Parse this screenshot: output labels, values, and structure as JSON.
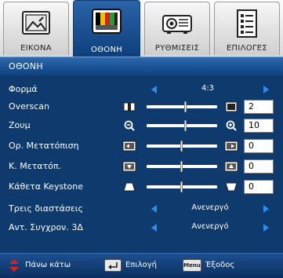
{
  "tabs": [
    {
      "label": "ΕΙΚΟΝΑ",
      "icon": "picture-icon"
    },
    {
      "label": "ΟΘΟΝΗ",
      "icon": "screen-icon"
    },
    {
      "label": "ΡΥΘΜΙΣΕΙΣ",
      "icon": "projector-icon"
    },
    {
      "label": "ΕΠΙΛΟΓΕΣ",
      "icon": "options-icon"
    }
  ],
  "title": "ΟΘΟΝΗ",
  "rows": {
    "forma": {
      "label": "Φορμά",
      "value": "4:3"
    },
    "overscan": {
      "label": "Overscan",
      "value": "2",
      "level": 0.55
    },
    "zoom": {
      "label": "Ζουμ",
      "value": "10",
      "level": 0.55
    },
    "hshift": {
      "label": "Ορ. Μετατόπιση",
      "value": "0",
      "level": 0.5
    },
    "vshift": {
      "label": "Κ. Μετατόπ.",
      "value": "0",
      "level": 0.5
    },
    "keystone": {
      "label": "Κάθετα Keystone",
      "value": "0",
      "level": 0.5
    },
    "threed": {
      "label": "Τρεις διαστάσεις",
      "value": "Ανενεργό"
    },
    "sync3d": {
      "label": "Αντ. Συγχρον. 3Δ",
      "value": "Ανενεργό"
    }
  },
  "footer": {
    "updown": "Πάνω κάτω",
    "select": "Επιλογή",
    "menu_key": "Menu",
    "exit": "Έξοδος"
  },
  "colors": {
    "background": "#0e3a6e",
    "accent_arrow": "#2e8cf0",
    "active_tab": "#1a4f94",
    "footer_arrow": "#e02020"
  }
}
